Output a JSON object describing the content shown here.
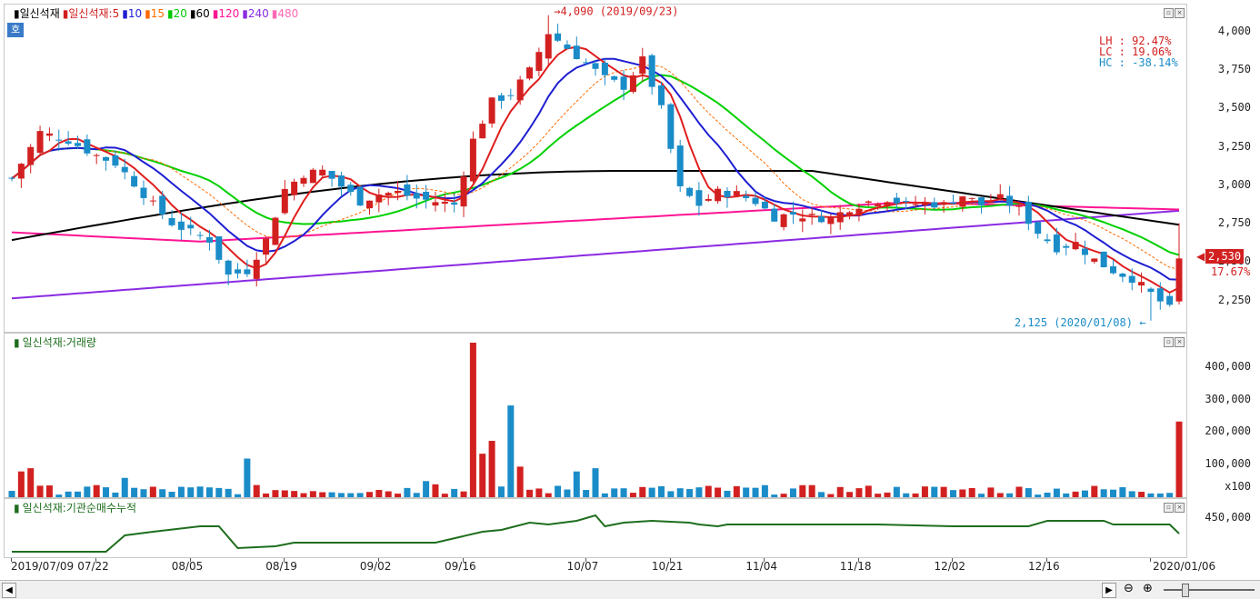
{
  "price_panel": {
    "legend": [
      {
        "label": "일신석재",
        "color": "#000000"
      },
      {
        "label": "일신석재:5",
        "color": "#d21e1e"
      },
      {
        "label": "10",
        "color": "#1e1ed2"
      },
      {
        "label": "15",
        "color": "#ff6a00"
      },
      {
        "label": "20",
        "color": "#00c800"
      },
      {
        "label": "60",
        "color": "#000000"
      },
      {
        "label": "120",
        "color": "#ff1493"
      },
      {
        "label": "240",
        "color": "#8a2be2"
      },
      {
        "label": "480",
        "color": "#ff69b4"
      }
    ],
    "corner_tag": "호",
    "high_annotation": "4,090 (2019/09/23)",
    "low_annotation": "2,125 (2020/01/08)",
    "lh": "LH :  92.47%",
    "lc": "LC :  19.06%",
    "hc": "HC : -38.14%",
    "current_price": "2,530",
    "current_change": "17.67%",
    "ticks": [
      "4,000",
      "3,750",
      "3,500",
      "3,250",
      "3,000",
      "2,750",
      "2,500",
      "2,250"
    ]
  },
  "volume_panel": {
    "title": "일신석재:거래량",
    "ticks": [
      "400,000",
      "300,000",
      "200,000",
      "100,000"
    ],
    "unit": "x100"
  },
  "inst_panel": {
    "title": "일신석재:기관순매수누적",
    "tick": "450,000"
  },
  "x_axis": [
    "2019/07/09",
    "07/22",
    "08/05",
    "08/19",
    "09/02",
    "09/16",
    "10/07",
    "10/21",
    "11/04",
    "11/18",
    "12/02",
    "12/16",
    "2020/01/06"
  ],
  "colors": {
    "up": "#d22020",
    "down": "#1a8cc8",
    "inst": "#1e6e1e"
  },
  "chart_data": {
    "type": "candlestick",
    "ylim": [
      2100,
      4100
    ],
    "dates": [
      "2019/07/09",
      "07/22",
      "08/05",
      "08/19",
      "09/02",
      "09/16",
      "10/07",
      "10/21",
      "11/04",
      "11/18",
      "12/02",
      "12/16",
      "2020/01/06"
    ],
    "high": 4090,
    "low": 2125,
    "last": 2530
  }
}
